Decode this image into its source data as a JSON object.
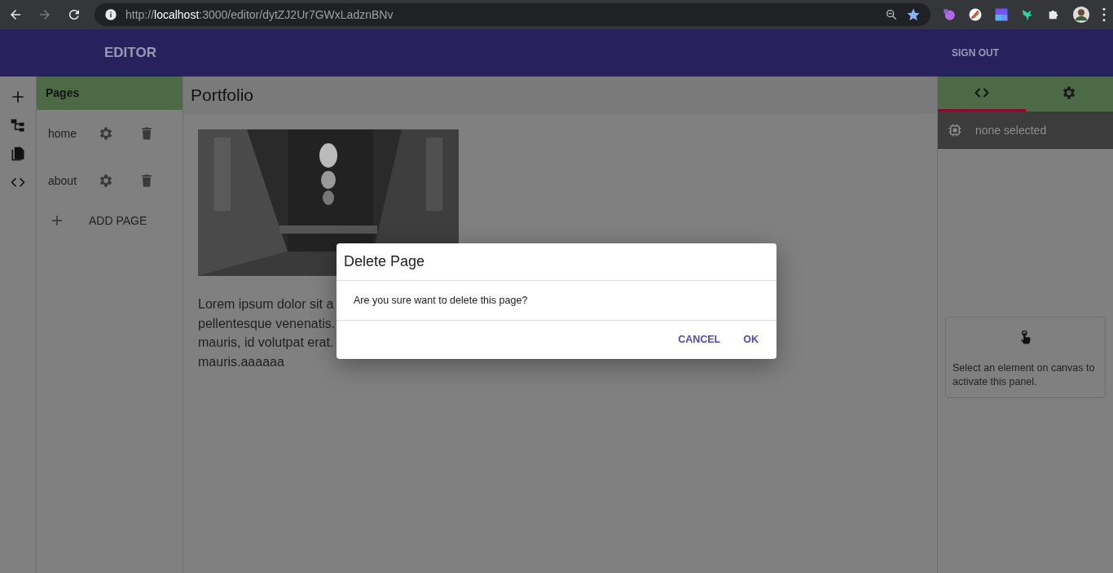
{
  "browser": {
    "back_disabled": false,
    "forward_disabled": true,
    "url": "http://**localhost**:3000/editor/dytZJ2Ur7GWxLadznBNv"
  },
  "header": {
    "title": "EDITOR",
    "sign_out": "SIGN OUT"
  },
  "pages_panel": {
    "title": "Pages",
    "pages": [
      {
        "name": "home"
      },
      {
        "name": "about"
      }
    ],
    "add_page": "ADD PAGE"
  },
  "canvas": {
    "title": "Portfolio",
    "text_lines": [
      "Lorem ipsum dolor sit a",
      "pellentesque venenatis.",
      "mauris, id volutpat erat.",
      "mauris.aaaaaa"
    ]
  },
  "properties_panel": {
    "tabs": [
      {
        "kind": "code",
        "selected": true
      },
      {
        "kind": "settings",
        "selected": false
      }
    ],
    "selection": "none selected",
    "hint": "Select an element on canvas to activate this panel."
  },
  "dialog": {
    "title": "Delete Page",
    "message": "Are you sure want to delete this page?",
    "buttons": [
      "CANCEL",
      "OK"
    ]
  }
}
